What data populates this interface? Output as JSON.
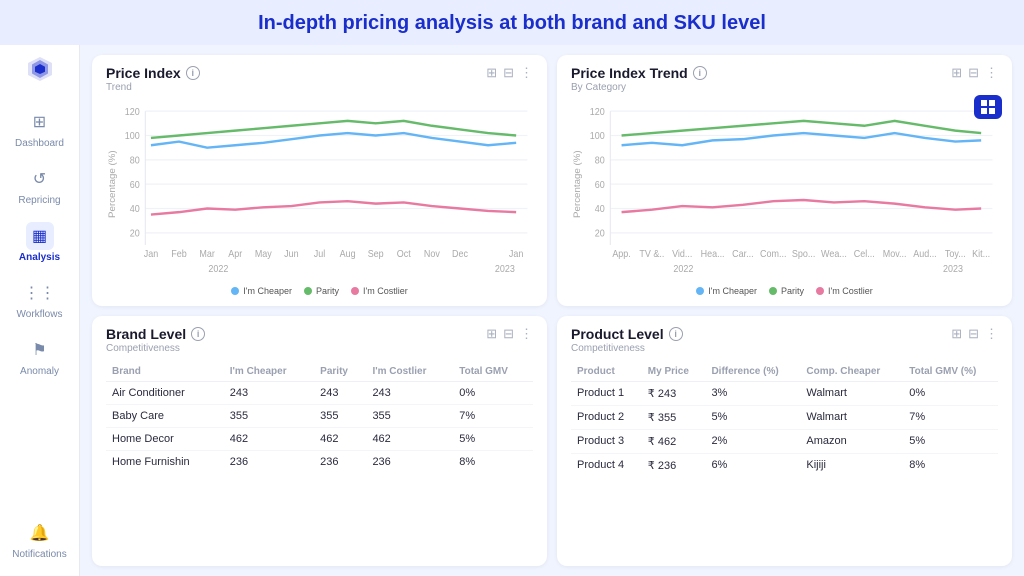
{
  "header": {
    "title": "In-depth pricing analysis at both brand and SKU level"
  },
  "sidebar": {
    "logo_symbol": "◆",
    "items": [
      {
        "id": "dashboard",
        "label": "Dashboard",
        "icon": "⊞",
        "active": false
      },
      {
        "id": "repricing",
        "label": "Repricing",
        "icon": "↺",
        "active": false
      },
      {
        "id": "analysis",
        "label": "Analysis",
        "icon": "📊",
        "active": true
      },
      {
        "id": "workflows",
        "label": "Workflows",
        "icon": "⋮⋮",
        "active": false
      },
      {
        "id": "anomaly",
        "label": "Anomaly",
        "icon": "⚠",
        "active": false
      },
      {
        "id": "notifications",
        "label": "Notifications",
        "icon": "🔔",
        "active": false
      }
    ]
  },
  "price_index_chart": {
    "title": "Price Index",
    "subtitle": "Trend",
    "info": "i",
    "x_labels": [
      "Jan",
      "Feb",
      "Mar",
      "Apr",
      "May",
      "Jun",
      "Jul",
      "Aug",
      "Sep",
      "Oct",
      "Nov",
      "Dec",
      "Jan"
    ],
    "year_labels": [
      "2022",
      "2023"
    ],
    "y_labels": [
      "20",
      "40",
      "60",
      "80",
      "100",
      "120"
    ],
    "legend": [
      {
        "label": "I'm Cheaper",
        "color": "#64b5f6"
      },
      {
        "label": "Parity",
        "color": "#66bb6a"
      },
      {
        "label": "I'm Costlier",
        "color": "#e879a0"
      }
    ]
  },
  "price_index_trend_chart": {
    "title": "Price Index Trend",
    "subtitle": "By Category",
    "info": "i",
    "x_labels": [
      "App.",
      "TV &..",
      "Vid...",
      "Hea...",
      "Car...",
      "Com...",
      "Spo...",
      "Wea...",
      "Cel...",
      "Mov...",
      "Aud...",
      "Toy...",
      "Kit..."
    ],
    "year_labels": [
      "2022",
      "2023"
    ],
    "y_labels": [
      "20",
      "40",
      "60",
      "80",
      "100",
      "120"
    ],
    "legend": [
      {
        "label": "I'm Cheaper",
        "color": "#64b5f6"
      },
      {
        "label": "Parity",
        "color": "#66bb6a"
      },
      {
        "label": "I'm Costlier",
        "color": "#e879a0"
      }
    ]
  },
  "brand_level": {
    "title": "Brand Level",
    "subtitle": "Competitiveness",
    "info": "i",
    "columns": [
      "Brand",
      "I'm Cheaper",
      "Parity",
      "I'm Costlier",
      "Total GMV"
    ],
    "rows": [
      {
        "brand": "Air Conditioner",
        "cheaper": "243",
        "parity": "243",
        "costlier": "243",
        "gmv": "0%"
      },
      {
        "brand": "Baby Care",
        "cheaper": "355",
        "parity": "355",
        "costlier": "355",
        "gmv": "7%"
      },
      {
        "brand": "Home Decor",
        "cheaper": "462",
        "parity": "462",
        "costlier": "462",
        "gmv": "5%"
      },
      {
        "brand": "Home Furnishin",
        "cheaper": "236",
        "parity": "236",
        "costlier": "236",
        "gmv": "8%"
      }
    ]
  },
  "product_level": {
    "title": "Product Level",
    "subtitle": "Competitiveness",
    "info": "i",
    "columns": [
      "Product",
      "My Price",
      "Difference (%)",
      "Comp. Cheaper",
      "Total GMV (%)"
    ],
    "rows": [
      {
        "product": "Product 1",
        "price": "₹ 243",
        "diff": "3%",
        "comp": "Walmart",
        "gmv": "0%"
      },
      {
        "product": "Product 2",
        "price": "₹ 355",
        "diff": "5%",
        "comp": "Walmart",
        "gmv": "7%"
      },
      {
        "product": "Product 3",
        "price": "₹ 462",
        "diff": "2%",
        "comp": "Amazon",
        "gmv": "5%"
      },
      {
        "product": "Product 4",
        "price": "₹ 236",
        "diff": "6%",
        "comp": "Kijiji",
        "gmv": "8%"
      }
    ]
  },
  "colors": {
    "cheaper": "#64b5f6",
    "parity": "#66bb6a",
    "costlier": "#e879a0",
    "accent": "#1a2ecc"
  }
}
